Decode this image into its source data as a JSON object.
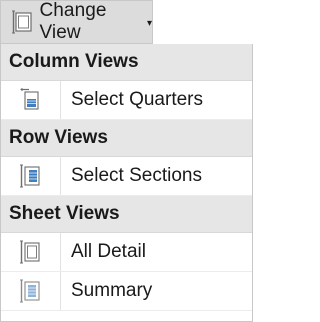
{
  "toolbar": {
    "change_view_label": "Change View",
    "change_view_icon": "view-layout-icon",
    "dropdown_caret": "▾"
  },
  "menu": {
    "sections": [
      {
        "header": "Column Views",
        "items": [
          {
            "label": "Select Quarters",
            "icon": "column-view-icon"
          }
        ]
      },
      {
        "header": "Row Views",
        "items": [
          {
            "label": "Select Sections",
            "icon": "row-view-icon"
          }
        ]
      },
      {
        "header": "Sheet Views",
        "items": [
          {
            "label": "All Detail",
            "icon": "sheet-view-icon"
          },
          {
            "label": "Summary",
            "icon": "sheet-summary-icon"
          }
        ]
      }
    ]
  },
  "colors": {
    "toolbar_bg": "#dcdcdc",
    "section_header_bg": "#e6e6e6",
    "icon_blue": "#3f7fbf",
    "icon_gray": "#7d7d7d"
  }
}
